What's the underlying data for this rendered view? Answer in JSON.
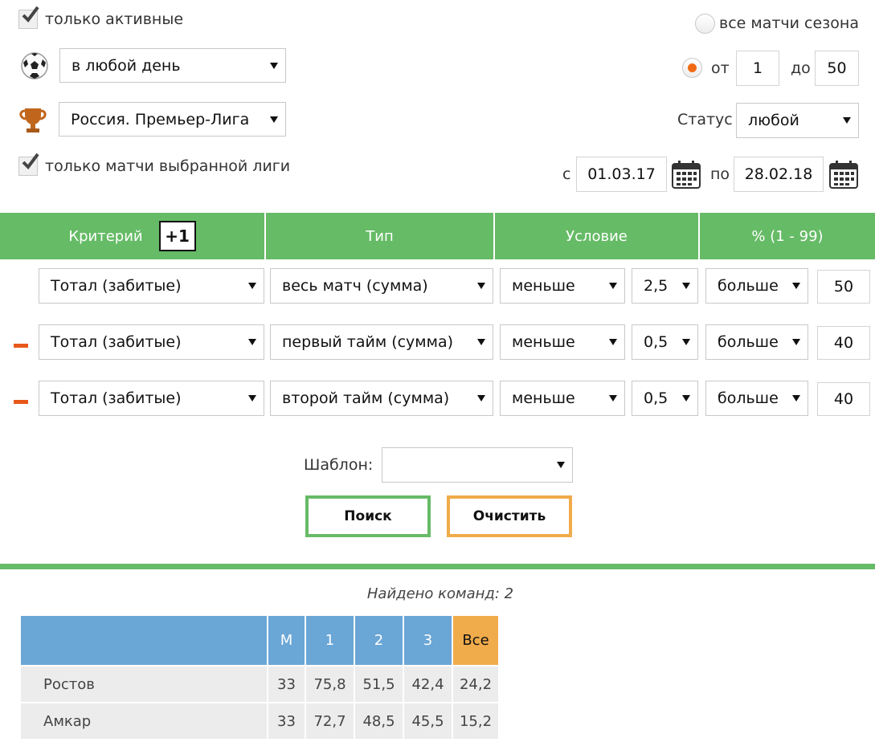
{
  "filters": {
    "only_active_label": "только активные",
    "only_active_checked": true,
    "day_select": "в любой день",
    "league_select": "Россия. Премьер-Лига",
    "only_league_label": "только матчи выбранной лиги",
    "only_league_checked": true,
    "all_season_label": "все матчи сезона",
    "from_label": "от",
    "from_value": "1",
    "to_label": "до",
    "to_value": "50",
    "status_label": "Статус",
    "status_value": "любой",
    "date_from_label": "с",
    "date_from": "01.03.17",
    "date_to_label": "по",
    "date_to": "28.02.18"
  },
  "criteria_header": {
    "criterion": "Критерий",
    "add_button": "+1",
    "type": "Тип",
    "condition": "Условие",
    "percent": "% (1 - 99)"
  },
  "criteria_rows": [
    {
      "criterion": "Тотал (забитые)",
      "type": "весь матч (сумма)",
      "condition": "меньше",
      "value": "2,5",
      "compare": "больше",
      "percent": "50"
    },
    {
      "criterion": "Тотал (забитые)",
      "type": "первый тайм (сумма)",
      "condition": "меньше",
      "value": "0,5",
      "compare": "больше",
      "percent": "40"
    },
    {
      "criterion": "Тотал (забитые)",
      "type": "второй тайм (сумма)",
      "condition": "меньше",
      "value": "0,5",
      "compare": "больше",
      "percent": "40"
    }
  ],
  "template": {
    "label": "Шаблон:",
    "value": ""
  },
  "buttons": {
    "search": "Поиск",
    "clear": "Очистить"
  },
  "colors": {
    "accent_green": "#66bb66",
    "accent_orange": "#f0ab4a",
    "table_blue": "#6aa6d6",
    "minus_orange": "#e8581a"
  },
  "results": {
    "found_text": "Найдено команд: 2",
    "columns": [
      "",
      "М",
      "1",
      "2",
      "3",
      "Все"
    ],
    "rows": [
      [
        "Ростов",
        "33",
        "75,8",
        "51,5",
        "42,4",
        "24,2"
      ],
      [
        "Амкар",
        "33",
        "72,7",
        "48,5",
        "45,5",
        "15,2"
      ]
    ]
  }
}
